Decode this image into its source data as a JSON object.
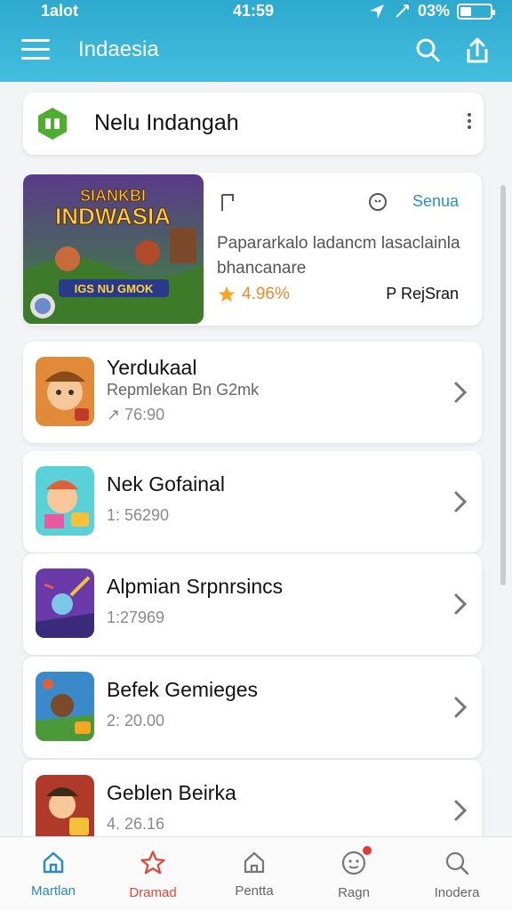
{
  "status_bar": {
    "carrier": "1alot",
    "time": "41:59",
    "battery": "03%"
  },
  "app_bar": {
    "title": "Indaesia"
  },
  "header_card": {
    "name": "Nelu Indangah"
  },
  "featured": {
    "banner_title": "SIANKBI",
    "banner_subtitle": "INDWASIA",
    "banner_tagline": "IGS NU GMOK",
    "action_label": "Senua",
    "description": "Papararkalo ladancm lasaclainla bhancanare",
    "rating": "4.96%",
    "publisher": "P RejSran"
  },
  "items": [
    {
      "title": "Yerdukaal",
      "subtitle": "Repmlekan Bn G2mk",
      "count": "76:90",
      "count_prefix": "↗"
    },
    {
      "title": "Nek Gofainal",
      "subtitle": "",
      "count": "1: 56290",
      "count_prefix": ""
    },
    {
      "title": "Alpmian Srpnrsincs",
      "subtitle": "",
      "count": "1:27969",
      "count_prefix": ""
    },
    {
      "title": "Befek Gemieges",
      "subtitle": "",
      "count": "2: 20.00",
      "count_prefix": ""
    },
    {
      "title": "Geblen Beirka",
      "subtitle": "",
      "count": "4. 26.16",
      "count_prefix": ""
    }
  ],
  "bottom_nav": [
    {
      "label": "Martlan",
      "icon": "home-icon",
      "state": "active"
    },
    {
      "label": "Dramad",
      "icon": "star-icon",
      "state": "highlight"
    },
    {
      "label": "Pentta",
      "icon": "house-icon",
      "state": "normal"
    },
    {
      "label": "Ragn",
      "icon": "face-icon",
      "state": "notification"
    },
    {
      "label": "Inodera",
      "icon": "search-icon",
      "state": "normal"
    }
  ],
  "colors": {
    "primary": "#3bb6d8",
    "accent": "#2b88c9",
    "rating": "#f08a2c",
    "alert": "#e0473a"
  }
}
